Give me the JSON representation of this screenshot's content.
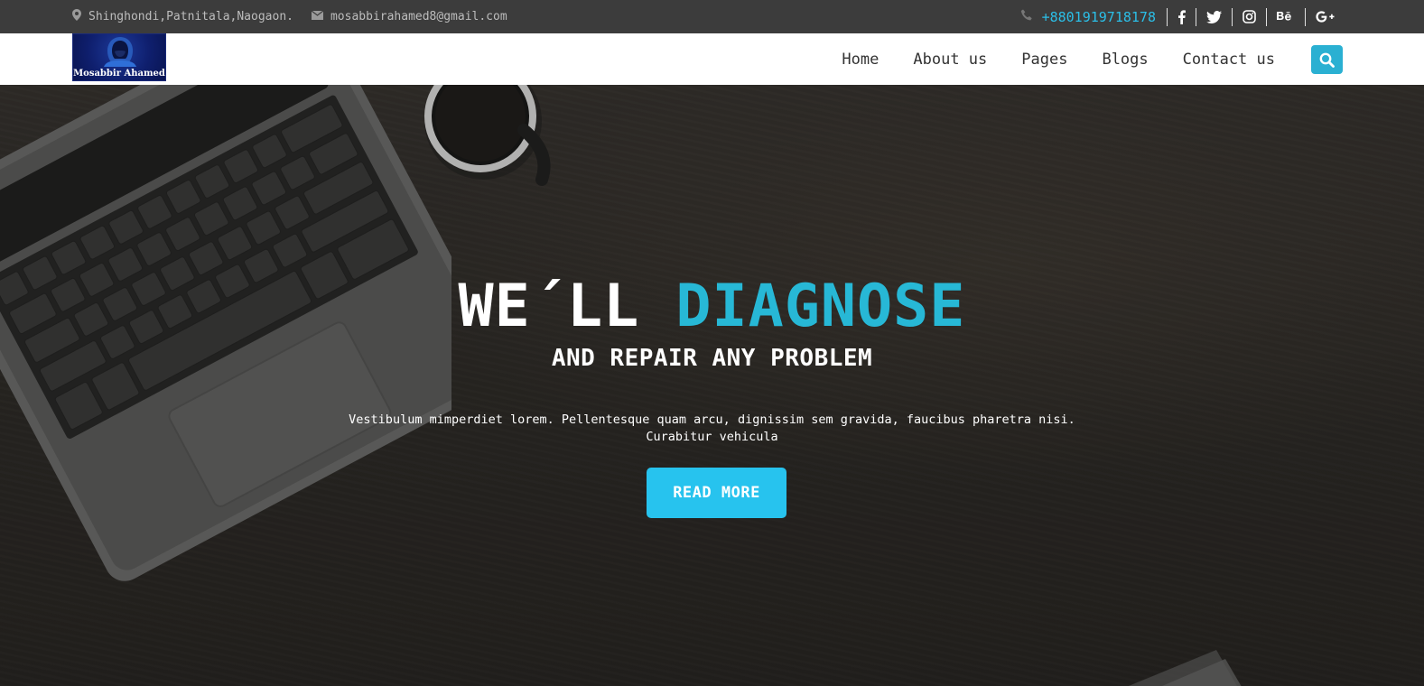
{
  "topbar": {
    "address": "Shinghondi,Patnitala,Naogaon.",
    "email": "mosabbirahamed8@gmail.com",
    "phone": "+8801919718178",
    "social": [
      "facebook-icon",
      "twitter-icon",
      "instagram-icon",
      "behance-icon",
      "google-plus-icon"
    ]
  },
  "logo": {
    "text": "Mosabbir Ahamed"
  },
  "nav": {
    "items": [
      "Home",
      "About us",
      "Pages",
      "Blogs",
      "Contact us"
    ]
  },
  "hero": {
    "headline_main": "WE´LL ",
    "headline_accent": "DIAGNOSE",
    "subheadline": "AND REPAIR ANY PROBLEM",
    "description": "Vestibulum mimperdiet lorem. Pellentesque quam arcu, dignissim sem gravida, faucibus pharetra nisi. Curabitur vehicula",
    "button": "READ MORE"
  },
  "colors": {
    "accent": "#27b8d6",
    "button": "#27c3ee",
    "topbar": "#3c3c3c"
  }
}
